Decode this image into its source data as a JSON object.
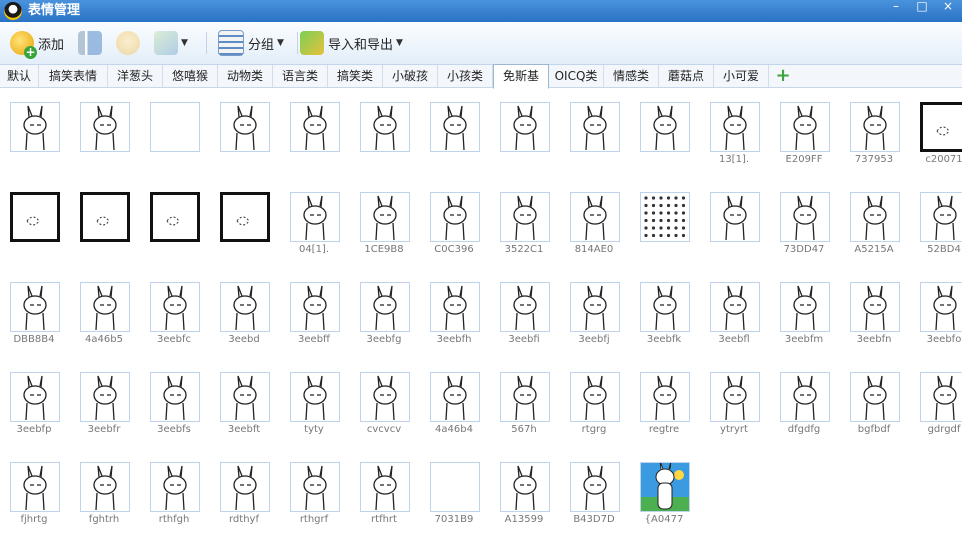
{
  "window": {
    "title": "表情管理",
    "minimize": "–",
    "maximize": "□",
    "close": "×"
  },
  "toolbar": {
    "add_label": "添加",
    "group_label": "分组",
    "io_label": "导入和导出"
  },
  "tabs": [
    "默认",
    "搞笑表情",
    "洋葱头",
    "悠嘻猴",
    "动物类",
    "语言类",
    "搞笑类",
    "小破孩",
    "小孩类",
    "免斯基",
    "OICQ类",
    "情感类",
    "蘑菇点",
    "小可爱"
  ],
  "active_tab": "免斯基",
  "emoticons": [
    [
      "",
      "",
      "",
      "",
      "",
      "",
      "",
      "",
      "",
      "",
      "13[1].",
      "E209FF",
      "737953",
      "c20071"
    ],
    [
      "",
      "",
      "",
      "",
      "04[1].",
      "1CE9B8",
      "C0C396",
      "3522C1",
      "814AE0",
      "",
      "",
      "73DD47",
      "A5215A",
      "52BD4"
    ],
    [
      "DBB8B4",
      "4a46b5",
      "3eebfc",
      "3eebd",
      "3eebff",
      "3eebfg",
      "3eebfh",
      "3eebfi",
      "3eebfj",
      "3eebfk",
      "3eebfl",
      "3eebfm",
      "3eebfn",
      "3eebfo"
    ],
    [
      "3eebfp",
      "3eebfr",
      "3eebfs",
      "3eebft",
      "tyty",
      "cvcvcv",
      "4a46b4",
      "567h",
      "rtgrg",
      "regtre",
      "ytryrt",
      "dfgdfg",
      "bgfbdf",
      "gdrgdf"
    ],
    [
      "fjhrtg",
      "fghtrh",
      "rthfgh",
      "rdthyf",
      "rthgrf",
      "rtfhrt",
      "7031B9",
      "A13599",
      "B43D7D",
      "{A0477"
    ]
  ],
  "icons": {
    "add": "smiley-plus-icon",
    "tools": "tools-icon",
    "face": "face-icon",
    "image": "image-icon",
    "group": "group-icon",
    "io": "import-export-icon",
    "tab_add": "plus-icon"
  }
}
